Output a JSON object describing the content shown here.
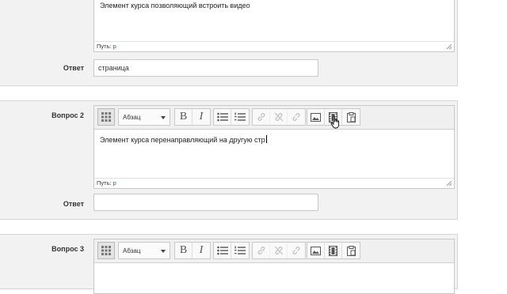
{
  "toolbar": {
    "format_select": "Абзац",
    "bold_label": "B",
    "italic_label": "I"
  },
  "editor": {
    "path_label": "Путь:",
    "path_value": "p"
  },
  "question1": {
    "text": "Элемент курса позволяющий встроить видео",
    "answer_label": "Ответ",
    "answer_value": "страница"
  },
  "question2": {
    "label": "Вопрос 2",
    "text": "Элемент курса перенаправляющий на другую стр",
    "answer_label": "Ответ",
    "answer_value": ""
  },
  "question3": {
    "label": "Вопрос 3",
    "text": ""
  },
  "colors": {
    "panel_bg": "#f2f2f2",
    "link_blue": "#1f5f9a"
  }
}
